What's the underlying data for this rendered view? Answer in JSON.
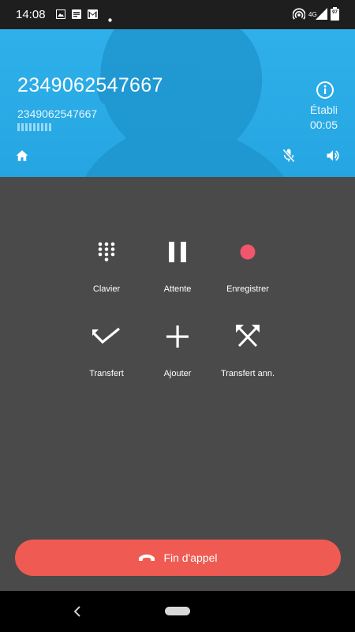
{
  "status_bar": {
    "time": "14:08",
    "battery": "97",
    "network": "4G"
  },
  "call": {
    "number": "2349062547667",
    "sub_number": "2349062547667",
    "status": "Établi",
    "duration": "00:05"
  },
  "controls": {
    "keypad": "Clavier",
    "hold": "Attente",
    "record": "Enregistrer",
    "transfer": "Transfert",
    "add": "Ajouter",
    "attended_transfer": "Transfert ann."
  },
  "end_call": {
    "label": "Fin d'appel"
  },
  "colors": {
    "header": "#27a8e4",
    "body": "#4a4a4a",
    "end_call": "#ef5b52",
    "record_dot": "#f2566c"
  }
}
